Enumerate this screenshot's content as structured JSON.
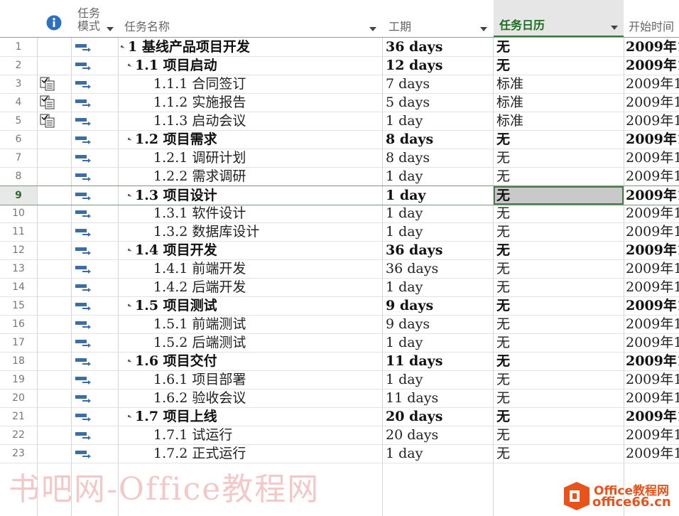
{
  "header": {
    "info_icon": "info-icon",
    "mode": "任务\n模式",
    "mode_l1": "任务",
    "mode_l2": "模式",
    "name": "任务名称",
    "duration": "工期",
    "calendar": "任务日历",
    "start": "开始时间"
  },
  "colors": {
    "accent": "#2e7d32",
    "selected_cell": "#c9c9c9",
    "watermark": "#f2c8c8"
  },
  "rows": [
    {
      "n": "1",
      "indent": 0,
      "tri": true,
      "name": "1 基线产品项目开发",
      "dur": "36 days",
      "cal": "无",
      "start": "2009年1",
      "bold": true,
      "note": false
    },
    {
      "n": "2",
      "indent": 1,
      "tri": true,
      "name": "1.1 项目启动",
      "dur": "12 days",
      "cal": "无",
      "start": "2009年1",
      "bold": true,
      "note": false
    },
    {
      "n": "3",
      "indent": 2,
      "tri": false,
      "name": "1.1.1 合同签订",
      "dur": "7 days",
      "cal": "标准",
      "start": "2009年1",
      "bold": false,
      "note": true
    },
    {
      "n": "4",
      "indent": 2,
      "tri": false,
      "name": "1.1.2 实施报告",
      "dur": "5 days",
      "cal": "标准",
      "start": "2009年1",
      "bold": false,
      "note": true
    },
    {
      "n": "5",
      "indent": 2,
      "tri": false,
      "name": "1.1.3 启动会议",
      "dur": "1 day",
      "cal": "标准",
      "start": "2009年1",
      "bold": false,
      "note": true
    },
    {
      "n": "6",
      "indent": 1,
      "tri": true,
      "name": "1.2 项目需求",
      "dur": "8 days",
      "cal": "无",
      "start": "2009年1",
      "bold": true,
      "note": false
    },
    {
      "n": "7",
      "indent": 2,
      "tri": false,
      "name": "1.2.1 调研计划",
      "dur": "8 days",
      "cal": "无",
      "start": "2009年1",
      "bold": false,
      "note": false
    },
    {
      "n": "8",
      "indent": 2,
      "tri": false,
      "name": "1.2.2 需求调研",
      "dur": "1 day",
      "cal": "无",
      "start": "2009年1",
      "bold": false,
      "note": false
    },
    {
      "n": "9",
      "indent": 1,
      "tri": true,
      "name": "1.3 项目设计",
      "dur": "1 day",
      "cal": "无",
      "start": "2009年1",
      "bold": true,
      "note": false,
      "selected": true
    },
    {
      "n": "10",
      "indent": 2,
      "tri": false,
      "name": "1.3.1 软件设计",
      "dur": "1 day",
      "cal": "无",
      "start": "2009年1",
      "bold": false,
      "note": false
    },
    {
      "n": "11",
      "indent": 2,
      "tri": false,
      "name": "1.3.2 数据库设计",
      "dur": "1 day",
      "cal": "无",
      "start": "2009年1",
      "bold": false,
      "note": false
    },
    {
      "n": "12",
      "indent": 1,
      "tri": true,
      "name": "1.4 项目开发",
      "dur": "36 days",
      "cal": "无",
      "start": "2009年1",
      "bold": true,
      "note": false
    },
    {
      "n": "13",
      "indent": 2,
      "tri": false,
      "name": "1.4.1 前端开发",
      "dur": "36 days",
      "cal": "无",
      "start": "2009年1",
      "bold": false,
      "note": false
    },
    {
      "n": "14",
      "indent": 2,
      "tri": false,
      "name": "1.4.2 后端开发",
      "dur": "1 day",
      "cal": "无",
      "start": "2009年1",
      "bold": false,
      "note": false
    },
    {
      "n": "15",
      "indent": 1,
      "tri": true,
      "name": "1.5 项目测试",
      "dur": "9 days",
      "cal": "无",
      "start": "2009年1",
      "bold": true,
      "note": false
    },
    {
      "n": "16",
      "indent": 2,
      "tri": false,
      "name": "1.5.1 前端测试",
      "dur": "9 days",
      "cal": "无",
      "start": "2009年1",
      "bold": false,
      "note": false
    },
    {
      "n": "17",
      "indent": 2,
      "tri": false,
      "name": "1.5.2 后端测试",
      "dur": "1 day",
      "cal": "无",
      "start": "2009年1",
      "bold": false,
      "note": false
    },
    {
      "n": "18",
      "indent": 1,
      "tri": true,
      "name": "1.6 项目交付",
      "dur": "11 days",
      "cal": "无",
      "start": "2009年1",
      "bold": true,
      "note": false
    },
    {
      "n": "19",
      "indent": 2,
      "tri": false,
      "name": "1.6.1 项目部署",
      "dur": "1 day",
      "cal": "无",
      "start": "2009年1",
      "bold": false,
      "note": false
    },
    {
      "n": "20",
      "indent": 2,
      "tri": false,
      "name": "1.6.2 验收会议",
      "dur": "11 days",
      "cal": "无",
      "start": "2009年1",
      "bold": false,
      "note": false
    },
    {
      "n": "21",
      "indent": 1,
      "tri": true,
      "name": "1.7 项目上线",
      "dur": "20 days",
      "cal": "无",
      "start": "2009年1",
      "bold": true,
      "note": false
    },
    {
      "n": "22",
      "indent": 2,
      "tri": false,
      "name": "1.7.1 试运行",
      "dur": "20 days",
      "cal": "无",
      "start": "2009年1",
      "bold": false,
      "note": false
    },
    {
      "n": "23",
      "indent": 2,
      "tri": false,
      "name": "1.7.2 正式运行",
      "dur": "1 day",
      "cal": "无",
      "start": "2009年1",
      "bold": false,
      "note": false
    }
  ],
  "watermark": "书吧网-Office教程网",
  "logo": {
    "line1": "Office教程网",
    "line2": "office66.cn"
  }
}
